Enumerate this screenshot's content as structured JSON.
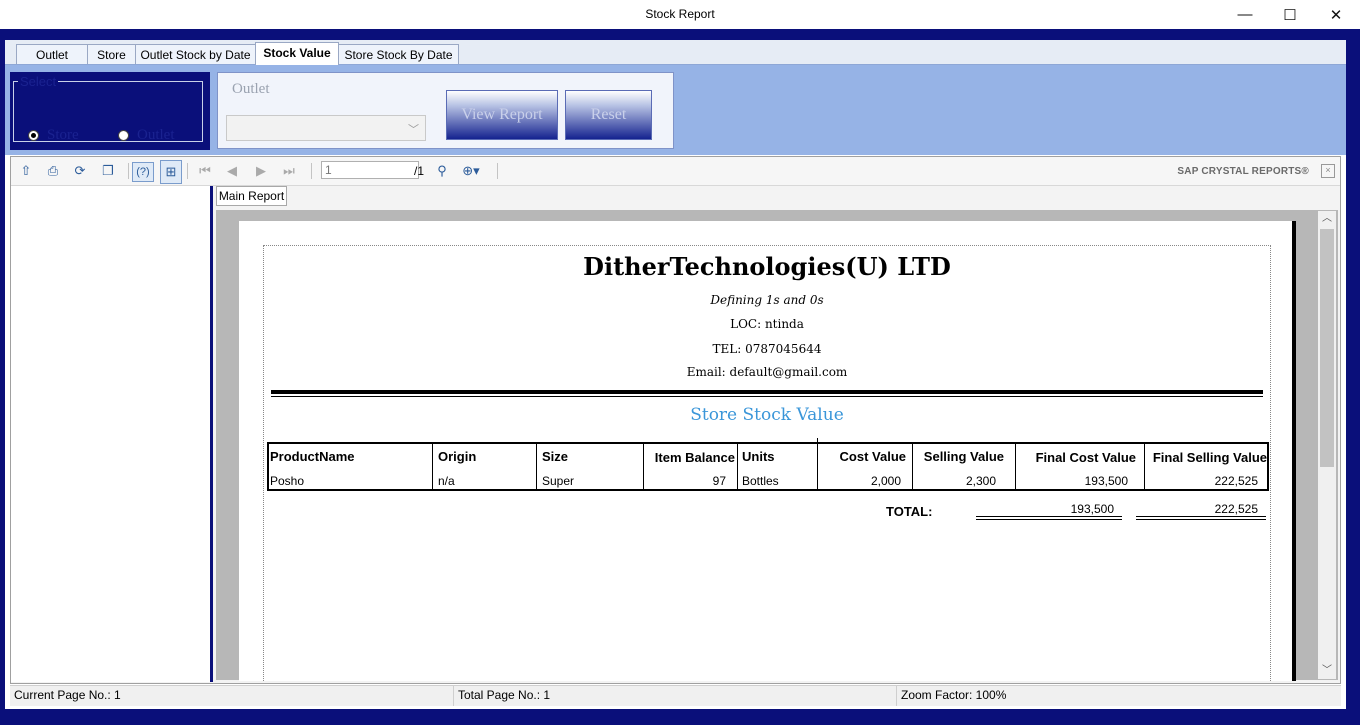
{
  "window": {
    "title": "Stock Report",
    "controls": {
      "minimize": "—",
      "maximize": "☐",
      "close": "✕"
    }
  },
  "tabs": [
    {
      "label": "Outlet",
      "active": false
    },
    {
      "label": "Store",
      "active": false
    },
    {
      "label": "Outlet Stock by Date",
      "active": false
    },
    {
      "label": "Stock Value",
      "active": true
    },
    {
      "label": "Store Stock By Date",
      "active": false
    }
  ],
  "select_group": {
    "legend": "Select",
    "options": [
      {
        "label": "Store",
        "checked": true
      },
      {
        "label": "Outlet",
        "checked": false
      }
    ]
  },
  "outlet_panel": {
    "label": "Outlet",
    "combo_value": "",
    "view_report_label": "View Report",
    "reset_label": "Reset"
  },
  "toolbar": {
    "page_input": "1",
    "page_total": "/1",
    "brand": "SAP CRYSTAL REPORTS®",
    "icons": [
      "export-icon",
      "print-icon",
      "refresh-icon",
      "copy-icon",
      "help-icon",
      "group-tree-icon",
      "first-page-icon",
      "previous-page-icon",
      "next-page-icon",
      "last-page-icon",
      "find-icon",
      "zoom-icon"
    ]
  },
  "report_tab": "Main Report",
  "report": {
    "company": "DitherTechnologies(U) LTD",
    "tagline": "Defining 1s and 0s",
    "location": "LOC: ntinda",
    "tel": "TEL: 0787045644",
    "email": "Email: default@gmail.com",
    "title": "Store Stock Value",
    "columns": [
      "ProductName",
      "Origin",
      "Size",
      "Item Balance",
      "Units",
      "Cost Value",
      "Selling Value",
      "Final Cost Value",
      "Final Selling Value"
    ],
    "rows": [
      [
        "Posho",
        "n/a",
        "Super",
        "97",
        "Bottles",
        "2,000",
        "2,300",
        "193,500",
        "222,525"
      ]
    ],
    "total_label": "TOTAL:",
    "total_cost": "193,500",
    "total_selling": "222,525",
    "title_color": "#3a96d9"
  },
  "status": {
    "current_page": "Current Page No.: 1",
    "total_page": "Total Page No.: 1",
    "zoom": "Zoom Factor: 100%"
  }
}
